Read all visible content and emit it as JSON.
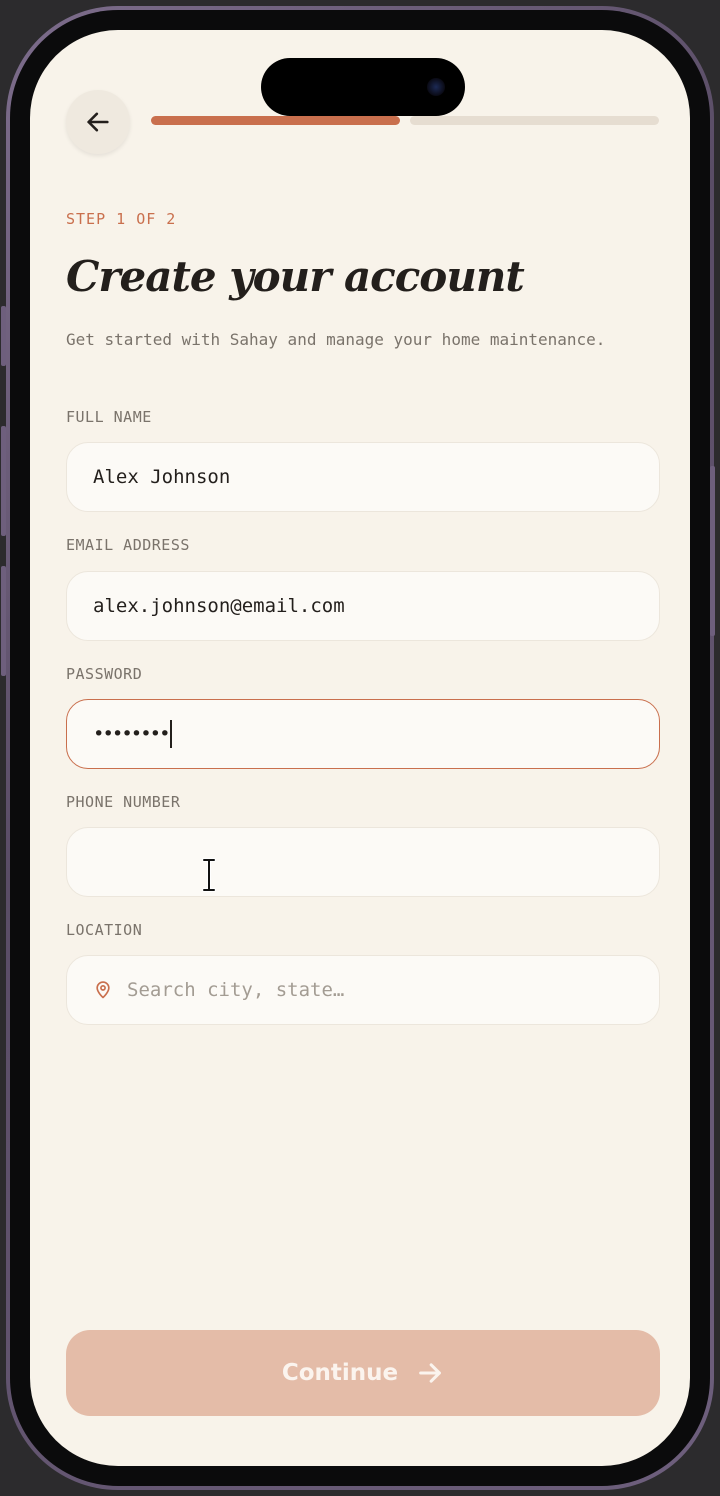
{
  "onboarding": {
    "step_label": "STEP 1 OF 2",
    "title": "Create your account",
    "subtitle": "Get started with Sahay and manage your home maintenance.",
    "progress": {
      "current_step": 1,
      "total_steps": 2
    }
  },
  "form": {
    "full_name": {
      "label": "FULL NAME",
      "value": "Alex Johnson"
    },
    "email": {
      "label": "EMAIL ADDRESS",
      "value": "alex.johnson@email.com"
    },
    "password": {
      "label": "PASSWORD",
      "masked_value": "••••••••"
    },
    "phone": {
      "label": "PHONE NUMBER",
      "value": ""
    },
    "location": {
      "label": "LOCATION",
      "placeholder": "Search city, state…"
    }
  },
  "actions": {
    "continue_label": "Continue"
  },
  "icons": {
    "back": "arrow-left-icon",
    "location": "map-pin-icon",
    "continue": "arrow-right-icon"
  },
  "colors": {
    "accent": "#c96f4d",
    "background": "#f8f3ea",
    "button_disabled": "#e4bca8",
    "text": "#231f1c"
  }
}
